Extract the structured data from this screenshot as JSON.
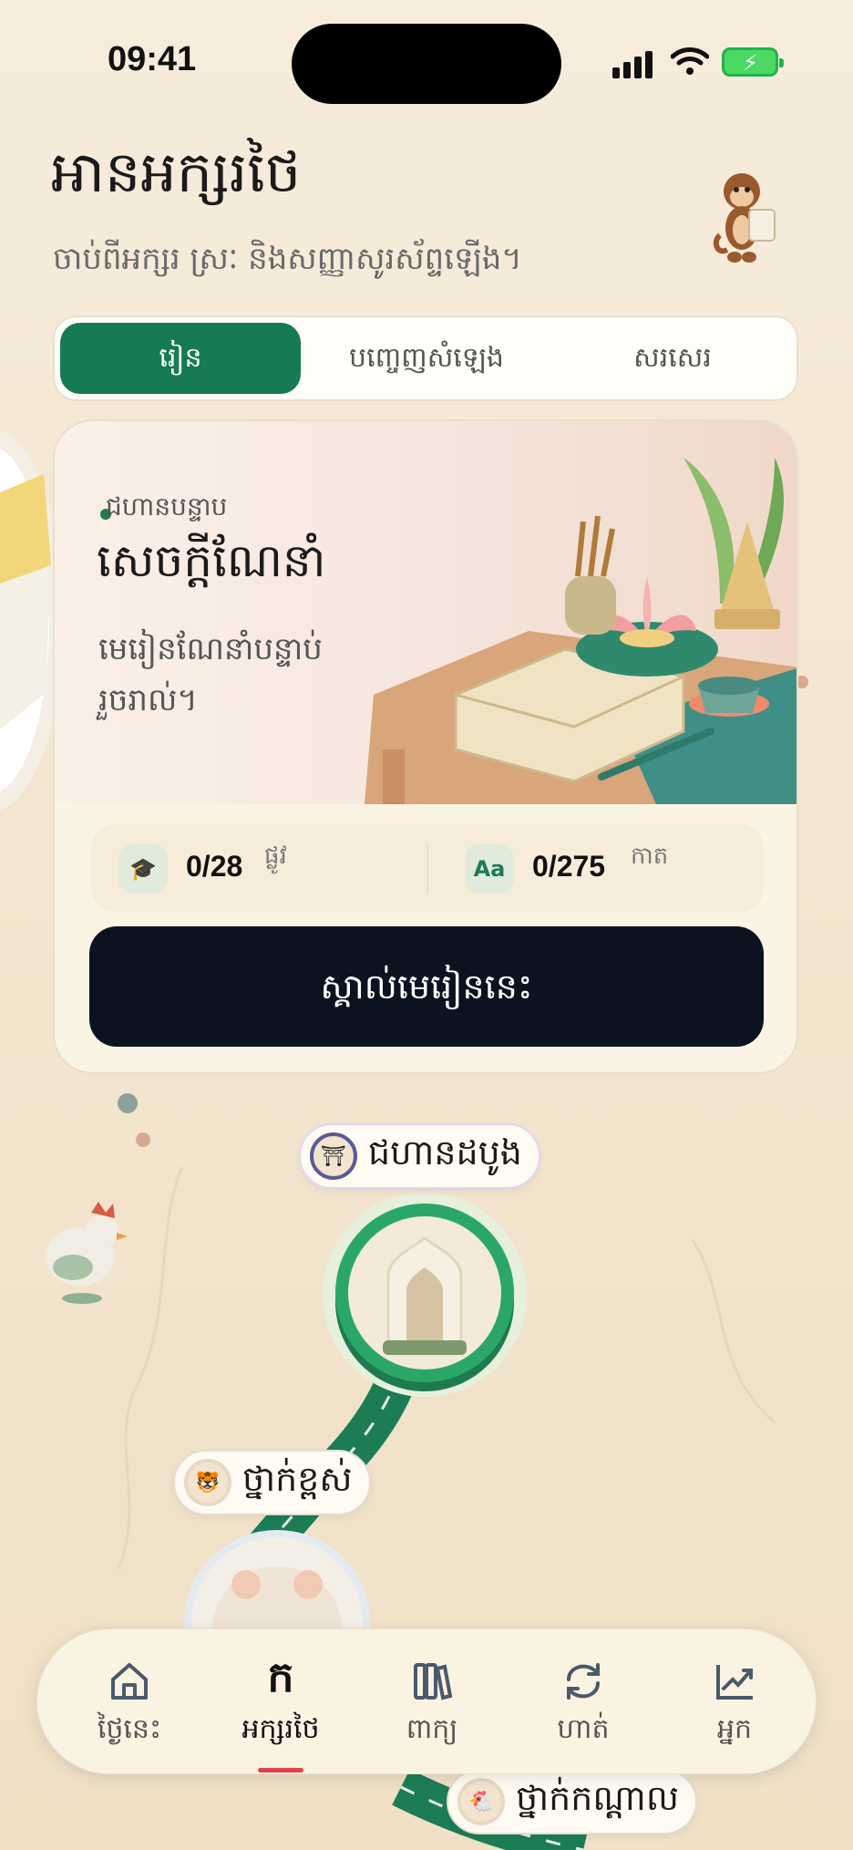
{
  "status": {
    "time": "09:41"
  },
  "header": {
    "title": "អានអក្សរថៃ",
    "subtitle": "ចាប់ពីអក្សរ ស្រៈ និងសញ្ញាសូរស័ព្ទឡើង។"
  },
  "tabs": [
    {
      "label": "រៀន",
      "active": true
    },
    {
      "label": "បញ្ចេញសំឡេង",
      "active": false
    },
    {
      "label": "សរសេរ",
      "active": false
    }
  ],
  "card": {
    "eyebrow": "ជហានបន្ទាប",
    "title": "សេចក្តីណែនាំ",
    "description": "មេរៀនណែនាំបន្ទាប់រួចរាល់។",
    "stats": [
      {
        "icon": "graduation-cap-icon",
        "value": "0/28",
        "unit": "ផ្លូវ"
      },
      {
        "icon": "text-aa-icon",
        "value": "0/275",
        "unit": "កាត"
      }
    ],
    "cta_label": "ស្គាល់មេរៀននេះ"
  },
  "path": {
    "nodes": [
      {
        "label": "ជហានដបូង"
      },
      {
        "label": "ថ្នាក់ខ្ពស់"
      },
      {
        "label": "ថ្នាក់កណ្តាល"
      }
    ]
  },
  "nav": {
    "items": [
      {
        "label": "ថ្ងៃនេះ",
        "icon": "home-icon",
        "active": false
      },
      {
        "label": "អក្សរថៃ",
        "icon": "ko-letter-icon",
        "glyph": "ក",
        "active": true
      },
      {
        "label": "ពាក្យ",
        "icon": "books-icon",
        "active": false
      },
      {
        "label": "ហាត់",
        "icon": "refresh-icon",
        "active": false
      },
      {
        "label": "អ្នក",
        "icon": "chart-icon",
        "active": false
      }
    ]
  },
  "colors": {
    "accent": "#167a55",
    "cta": "#0c1320",
    "active_nav_underline": "#e0424b"
  }
}
